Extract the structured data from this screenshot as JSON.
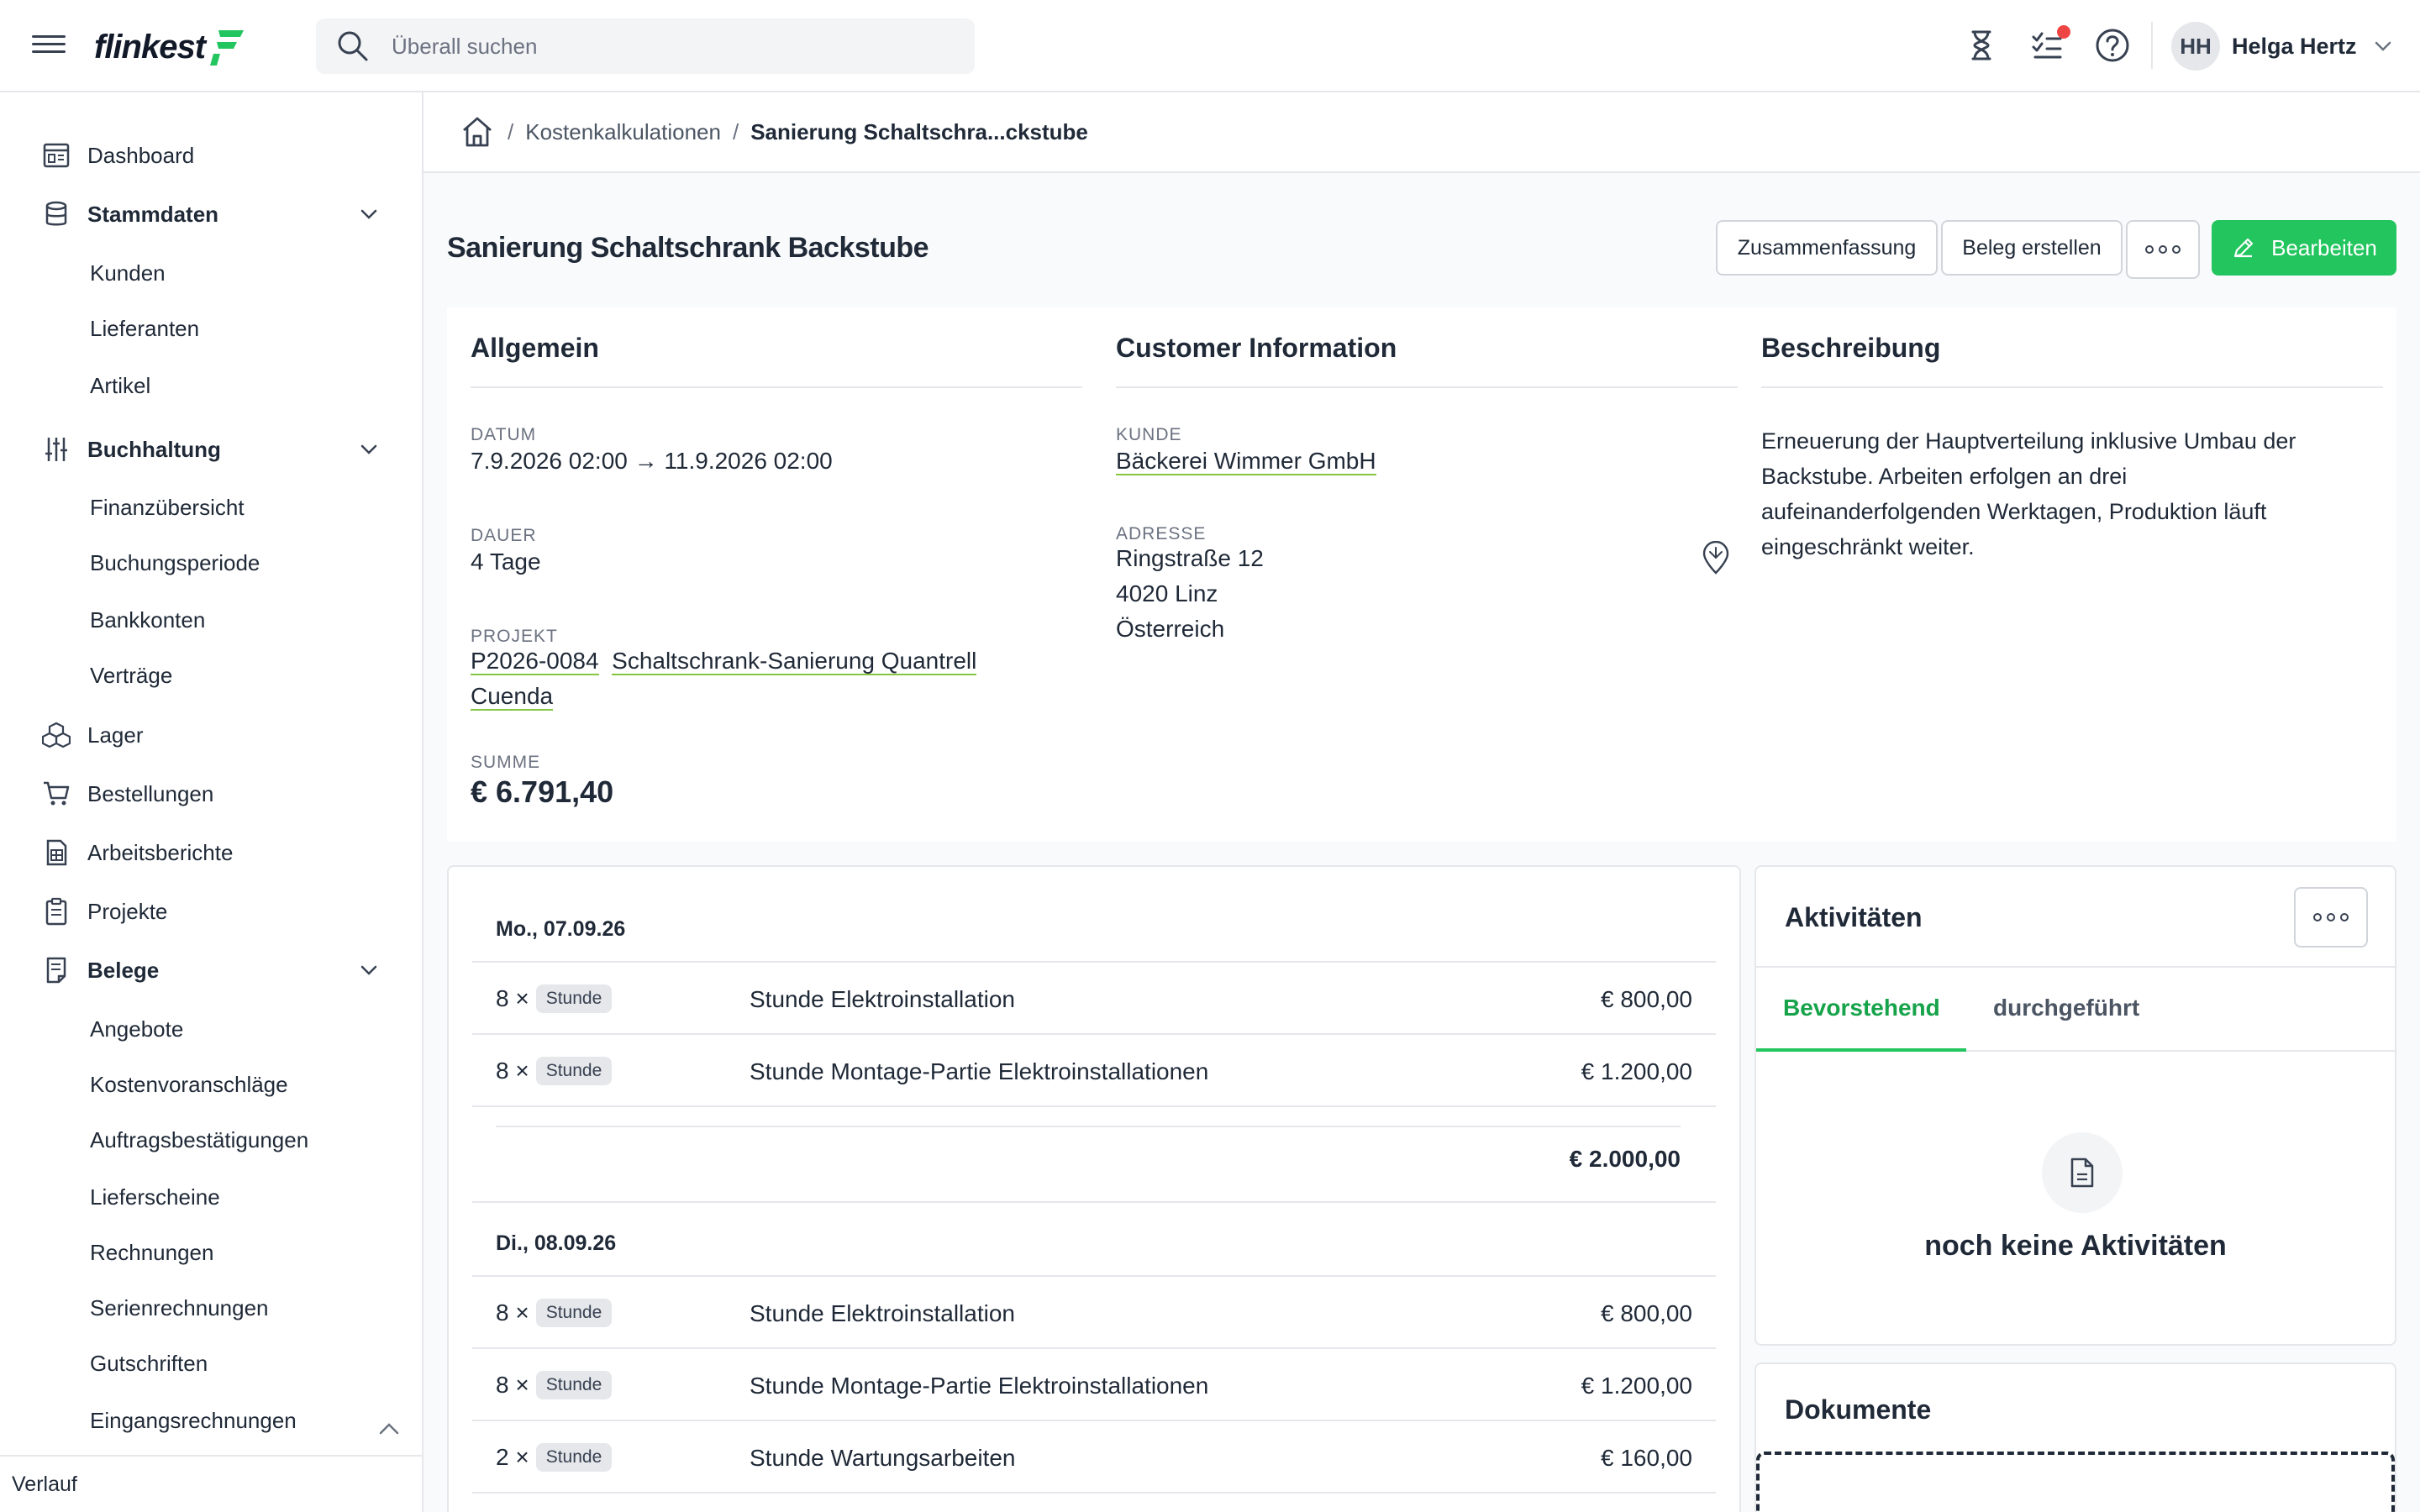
{
  "topbar": {
    "logo_text": "flinkest",
    "search_placeholder": "Überall suchen",
    "user": {
      "initials": "HH",
      "name": "Helga Hertz"
    }
  },
  "sidebar": {
    "items": [
      {
        "label": "Dashboard",
        "icon": "dashboard-icon"
      },
      {
        "label": "Stammdaten",
        "icon": "database-icon",
        "expanded": true,
        "children": [
          "Kunden",
          "Lieferanten",
          "Artikel"
        ]
      },
      {
        "label": "Buchhaltung",
        "icon": "sliders-icon",
        "expanded": true,
        "children": [
          "Finanzübersicht",
          "Buchungsperiode",
          "Bankkonten",
          "Verträge"
        ]
      },
      {
        "label": "Lager",
        "icon": "boxes-icon"
      },
      {
        "label": "Bestellungen",
        "icon": "cart-icon"
      },
      {
        "label": "Arbeitsberichte",
        "icon": "report-icon"
      },
      {
        "label": "Projekte",
        "icon": "clipboard-icon"
      },
      {
        "label": "Belege",
        "icon": "receipt-icon",
        "expanded": true,
        "children": [
          "Angebote",
          "Kostenvoranschläge",
          "Auftragsbestätigungen",
          "Lieferscheine",
          "Rechnungen",
          "Serienrechnungen",
          "Gutschriften",
          "Eingangsrechnungen"
        ]
      }
    ],
    "footer": "Verlauf"
  },
  "breadcrumb": {
    "parent": "Kostenkalkulationen",
    "current": "Sanierung Schaltschra...ckstube"
  },
  "page": {
    "title": "Sanierung Schaltschrank Backstube",
    "buttons": {
      "summary": "Zusammenfassung",
      "create_doc": "Beleg erstellen",
      "edit": "Bearbeiten"
    }
  },
  "general": {
    "heading": "Allgemein",
    "date_label": "DATUM",
    "date_value": "7.9.2026 02:00 → 11.9.2026 02:00",
    "duration_label": "DAUER",
    "duration_value": "4 Tage",
    "project_label": "PROJEKT",
    "project_number": "P2026-0084",
    "project_name": "Schaltschrank-Sanierung Quantrell",
    "project_name_2": "Cuenda",
    "sum_label": "SUMME",
    "sum_value": "€ 6.791,40"
  },
  "customer": {
    "heading": "Customer Information",
    "customer_label": "KUNDE",
    "customer_value": "Bäckerei Wimmer GmbH",
    "address_label": "ADRESSE",
    "address_line1": "Ringstraße 12",
    "address_line2": "4020 Linz",
    "address_line3": "Österreich"
  },
  "description": {
    "heading": "Beschreibung",
    "line1": "Erneuerung der Hauptverteilung inklusive Umbau der",
    "line2": "Backstube. Arbeiten erfolgen an drei",
    "line3": "aufeinanderfolgenden Werktagen, Produktion läuft",
    "line4": "eingeschränkt weiter."
  },
  "days": [
    {
      "label": "Mo., 07.09.26",
      "items": [
        {
          "qty": "8 ×",
          "unit": "Stunde",
          "name": "Stunde Elektroinstallation",
          "price": "€ 800,00"
        },
        {
          "qty": "8 ×",
          "unit": "Stunde",
          "name": "Stunde Montage-Partie Elektroinstallationen",
          "price": "€ 1.200,00"
        }
      ],
      "subtotal": "€ 2.000,00"
    },
    {
      "label": "Di., 08.09.26",
      "items": [
        {
          "qty": "8 ×",
          "unit": "Stunde",
          "name": "Stunde Elektroinstallation",
          "price": "€ 800,00"
        },
        {
          "qty": "8 ×",
          "unit": "Stunde",
          "name": "Stunde Montage-Partie Elektroinstallationen",
          "price": "€ 1.200,00"
        },
        {
          "qty": "2 ×",
          "unit": "Stunde",
          "name": "Stunde Wartungsarbeiten",
          "price": "€ 160,00"
        }
      ]
    }
  ],
  "activities": {
    "title": "Aktivitäten",
    "tabs": [
      "Bevorstehend",
      "durchgeführt"
    ],
    "empty": "noch keine Aktivitäten"
  },
  "documents": {
    "title": "Dokumente"
  },
  "colors": {
    "accent": "#22c55e",
    "link_underline": "#86c540",
    "notification": "#ef4444"
  }
}
